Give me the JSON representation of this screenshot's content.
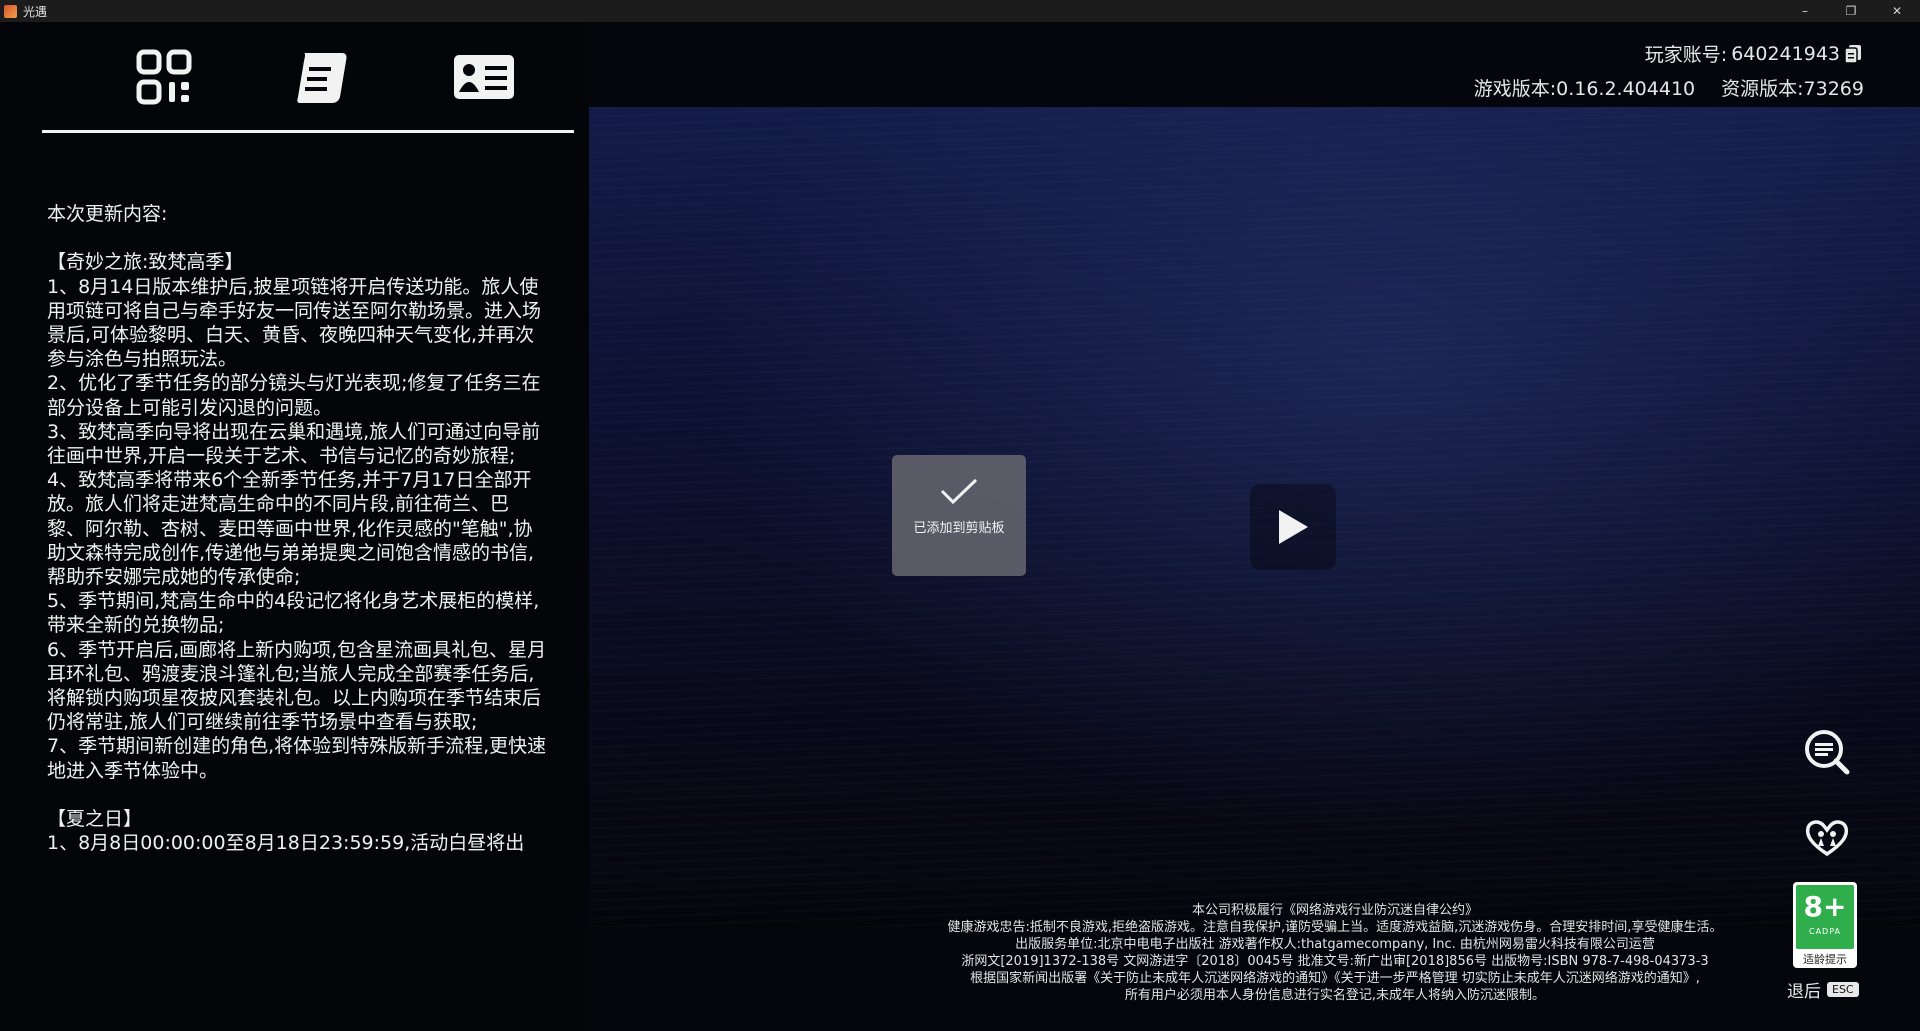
{
  "window": {
    "title": "光遇",
    "controls": {
      "minimize": "–",
      "restore": "❐",
      "close": "✕"
    }
  },
  "header": {
    "tabs": [
      {
        "icon": "qr-code-icon"
      },
      {
        "icon": "scroll-icon"
      },
      {
        "icon": "profile-card-icon"
      }
    ],
    "account_label": "玩家账号:",
    "account_id": "640241943",
    "game_version_label": "游戏版本:",
    "game_version": "0.16.2.404410",
    "resource_version_label": "资源版本:",
    "resource_version": "73269"
  },
  "notes": {
    "title": "本次更新内容:",
    "lines": [
      "",
      "【奇妙之旅:致梵高季】",
      "1、8月14日版本维护后,披星项链将开启传送功能。旅人使用项链可将自己与牵手好友一同传送至阿尔勒场景。进入场景后,可体验黎明、白天、黄昏、夜晚四种天气变化,并再次参与涂色与拍照玩法。",
      "2、优化了季节任务的部分镜头与灯光表现;修复了任务三在部分设备上可能引发闪退的问题。",
      "3、致梵高季向导将出现在云巢和遇境,旅人们可通过向导前往画中世界,开启一段关于艺术、书信与记忆的奇妙旅程;",
      "4、致梵高季将带来6个全新季节任务,并于7月17日全部开放。旅人们将走进梵高生命中的不同片段,前往荷兰、巴黎、阿尔勒、杏树、麦田等画中世界,化作灵感的\"笔触\",协助文森特完成创作,传递他与弟弟提奥之间饱含情感的书信,帮助乔安娜完成她的传承使命;",
      "5、季节期间,梵高生命中的4段记忆将化身艺术展柜的模样,带来全新的兑换物品;",
      "6、季节开启后,画廊将上新内购项,包含星流画具礼包、星月耳环礼包、鸦渡麦浪斗篷礼包;当旅人完成全部赛季任务后,将解锁内购项星夜披风套装礼包。以上内购项在季节结束后仍将常驻,旅人们可继续前往季节场景中查看与获取;",
      "7、季节期间新创建的角色,将体验到特殊版新手流程,更快速地进入季节体验中。",
      "",
      "【夏之日】",
      "1、8月8日00:00:00至8月18日23:59:59,活动白昼将出"
    ]
  },
  "toast": {
    "icon": "check-icon",
    "text": "已添加到剪贴板"
  },
  "player": {
    "play_icon": "play-icon"
  },
  "side_buttons": [
    {
      "icon": "notice-icon"
    },
    {
      "icon": "heart-friends-icon"
    }
  ],
  "rating": {
    "age": "8+",
    "org": "CADPA",
    "hint": "适龄提示"
  },
  "exit": {
    "label": "退后",
    "key": "ESC"
  },
  "legal": [
    "本公司积极履行《网络游戏行业防沉迷自律公约》",
    "健康游戏忠告:抵制不良游戏,拒绝盗版游戏。注意自我保护,谨防受骗上当。适度游戏益脑,沉迷游戏伤身。合理安排时间,享受健康生活。",
    "出版服务单位:北京中电电子出版社 游戏著作权人:thatgamecompany, Inc. 由杭州网易雷火科技有限公司运营",
    "浙网文[2019]1372-138号 文网游进字〔2018〕0045号 批准文号:新广出审[2018]856号 出版物号:ISBN 978-7-498-04373-3",
    "根据国家新闻出版署《关于防止未成年人沉迷网络游戏的通知》《关于进一步严格管理 切实防止未成年人沉迷网络游戏的通知》,",
    "所有用户必须用本人身份信息进行实名登记,未成年人将纳入防沉迷限制。"
  ]
}
